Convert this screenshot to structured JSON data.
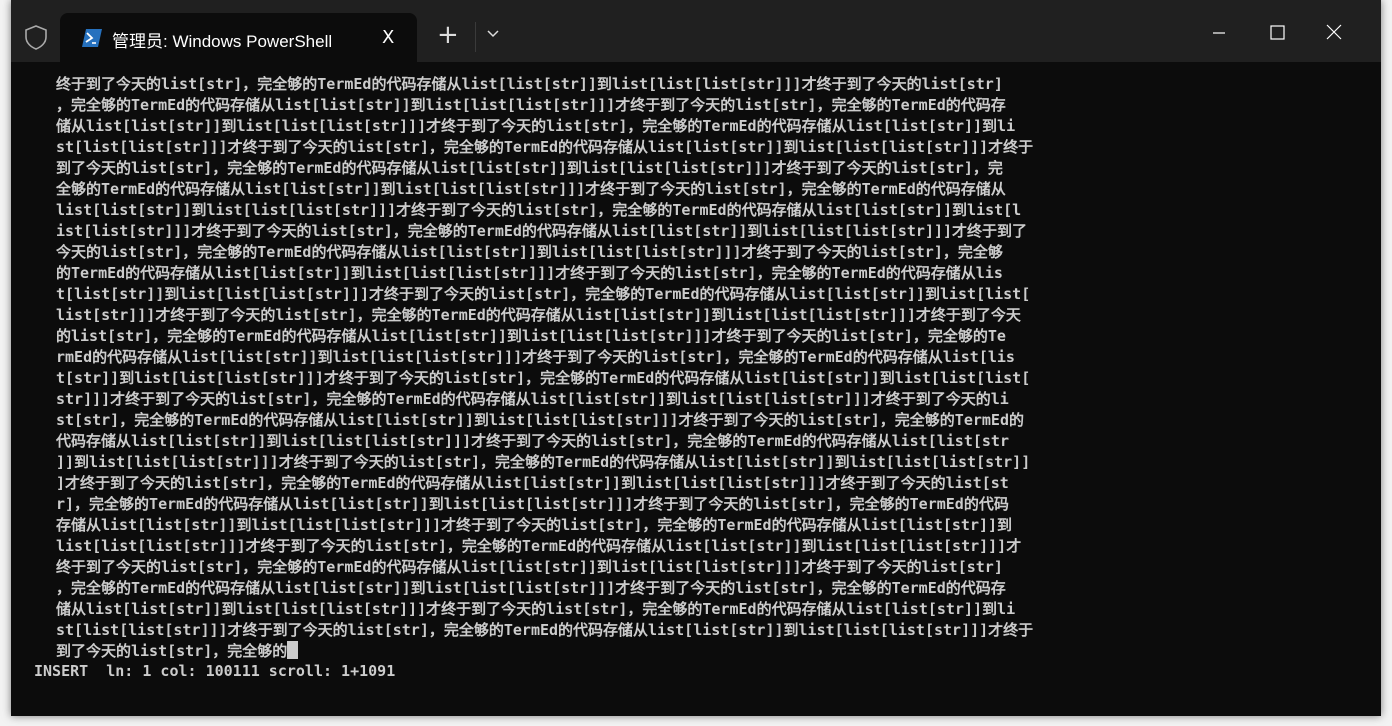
{
  "tab": {
    "title": "管理员: Windows PowerShell",
    "close": "X",
    "new_tab": "+"
  },
  "terminal": {
    "lines": [
      "终于到了今天的list[str]，完全够的TermEd的代码存储从list[list[str]]到list[list[list[str]]]才终于到了今天的list[str]",
      "，完全够的TermEd的代码存储从list[list[str]]到list[list[list[str]]]才终于到了今天的list[str]，完全够的TermEd的代码存",
      "储从list[list[str]]到list[list[list[str]]]才终于到了今天的list[str]，完全够的TermEd的代码存储从list[list[str]]到li",
      "st[list[list[str]]]才终于到了今天的list[str]，完全够的TermEd的代码存储从list[list[str]]到list[list[list[str]]]才终于",
      "到了今天的list[str]，完全够的TermEd的代码存储从list[list[str]]到list[list[list[str]]]才终于到了今天的list[str]，完",
      "全够的TermEd的代码存储从list[list[str]]到list[list[list[str]]]才终于到了今天的list[str]，完全够的TermEd的代码存储从",
      "list[list[str]]到list[list[list[str]]]才终于到了今天的list[str]，完全够的TermEd的代码存储从list[list[str]]到list[l",
      "ist[list[str]]]才终于到了今天的list[str]，完全够的TermEd的代码存储从list[list[str]]到list[list[list[str]]]才终于到了",
      "今天的list[str]，完全够的TermEd的代码存储从list[list[str]]到list[list[list[str]]]才终于到了今天的list[str]，完全够",
      "的TermEd的代码存储从list[list[str]]到list[list[list[str]]]才终于到了今天的list[str]，完全够的TermEd的代码存储从lis",
      "t[list[str]]到list[list[list[str]]]才终于到了今天的list[str]，完全够的TermEd的代码存储从list[list[str]]到list[list[",
      "list[str]]]才终于到了今天的list[str]，完全够的TermEd的代码存储从list[list[str]]到list[list[list[str]]]才终于到了今天",
      "的list[str]，完全够的TermEd的代码存储从list[list[str]]到list[list[list[str]]]才终于到了今天的list[str]，完全够的Te",
      "rmEd的代码存储从list[list[str]]到list[list[list[str]]]才终于到了今天的list[str]，完全够的TermEd的代码存储从list[lis",
      "t[str]]到list[list[list[str]]]才终于到了今天的list[str]，完全够的TermEd的代码存储从list[list[str]]到list[list[list[",
      "str]]]才终于到了今天的list[str]，完全够的TermEd的代码存储从list[list[str]]到list[list[list[str]]]才终于到了今天的li",
      "st[str]，完全够的TermEd的代码存储从list[list[str]]到list[list[list[str]]]才终于到了今天的list[str]，完全够的TermEd的",
      "代码存储从list[list[str]]到list[list[list[str]]]才终于到了今天的list[str]，完全够的TermEd的代码存储从list[list[str",
      "]]到list[list[list[str]]]才终于到了今天的list[str]，完全够的TermEd的代码存储从list[list[str]]到list[list[list[str]]",
      "]才终于到了今天的list[str]，完全够的TermEd的代码存储从list[list[str]]到list[list[list[str]]]才终于到了今天的list[st",
      "r]，完全够的TermEd的代码存储从list[list[str]]到list[list[list[str]]]才终于到了今天的list[str]，完全够的TermEd的代码",
      "存储从list[list[str]]到list[list[list[str]]]才终于到了今天的list[str]，完全够的TermEd的代码存储从list[list[str]]到",
      "list[list[list[str]]]才终于到了今天的list[str]，完全够的TermEd的代码存储从list[list[str]]到list[list[list[str]]]才",
      "终于到了今天的list[str]，完全够的TermEd的代码存储从list[list[str]]到list[list[list[str]]]才终于到了今天的list[str]",
      "，完全够的TermEd的代码存储从list[list[str]]到list[list[list[str]]]才终于到了今天的list[str]，完全够的TermEd的代码存",
      "储从list[list[str]]到list[list[list[str]]]才终于到了今天的list[str]，完全够的TermEd的代码存储从list[list[str]]到li",
      "st[list[list[str]]]才终于到了今天的list[str]，完全够的TermEd的代码存储从list[list[str]]到list[list[list[str]]]才终于",
      "到了今天的list[str]，完全够的"
    ],
    "status": "INSERT  ln: 1 col: 100111 scroll: 1+1091"
  },
  "colors": {
    "background": "#0c0c0c",
    "titlebar": "#202020",
    "text": "#cccccc",
    "powershell_icon": "#2671be"
  },
  "icons": [
    "shield-icon",
    "powershell-icon",
    "close-icon",
    "plus-icon",
    "chevron-down-icon",
    "minimize-icon",
    "maximize-icon",
    "window-close-icon"
  ]
}
